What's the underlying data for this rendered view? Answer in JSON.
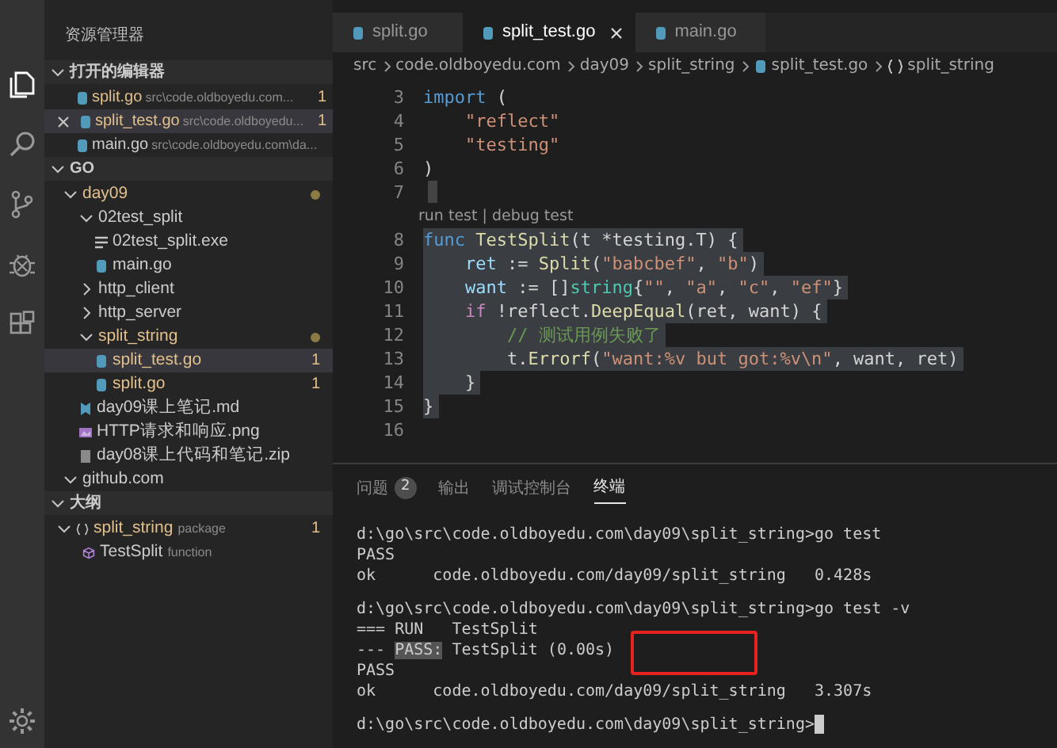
{
  "explorer": {
    "title": "资源管理器",
    "open_editors": {
      "title": "打开的编辑器",
      "expanded": true,
      "items": [
        {
          "name": "split.go",
          "path": "src\\code.oldboyedu.com...",
          "badge": "1",
          "modified": true,
          "selected": false
        },
        {
          "name": "split_test.go",
          "path": "src\\code.oldboyedu...",
          "badge": "1",
          "modified": true,
          "selected": true
        },
        {
          "name": "main.go",
          "path": "src\\code.oldboyedu.com\\da...",
          "modified": false,
          "selected": false
        }
      ]
    },
    "workspace": {
      "title": "GO",
      "expanded": true,
      "tree": [
        {
          "name": "day09",
          "kind": "folder",
          "expanded": true,
          "modified": true,
          "children": [
            {
              "name": "02test_split",
              "kind": "folder",
              "expanded": true,
              "modified": false,
              "children": [
                {
                  "name": "02test_split.exe",
                  "kind": "exe",
                  "modified": false,
                  "selected": false
                },
                {
                  "name": "main.go",
                  "kind": "go",
                  "modified": false,
                  "selected": false
                }
              ]
            },
            {
              "name": "http_client",
              "kind": "folder",
              "expanded": false,
              "modified": false
            },
            {
              "name": "http_server",
              "kind": "folder",
              "expanded": false,
              "modified": false
            },
            {
              "name": "split_string",
              "kind": "folder",
              "expanded": true,
              "modified": true,
              "children": [
                {
                  "name": "split_test.go",
                  "kind": "go",
                  "modified": true,
                  "badge": "1",
                  "selected": true
                },
                {
                  "name": "split.go",
                  "kind": "go",
                  "modified": true,
                  "badge": "1",
                  "selected": false
                }
              ]
            },
            {
              "name": "day09课上笔记.md",
              "kind": "md",
              "modified": false,
              "selected": false
            },
            {
              "name": "HTTP请求和响应.png",
              "kind": "png",
              "modified": false,
              "selected": false
            },
            {
              "name": "day08课上代码和笔记.zip",
              "kind": "zip",
              "modified": false,
              "selected": false
            }
          ]
        },
        {
          "name": "github.com",
          "kind": "folder",
          "expanded": true,
          "modified": false
        }
      ]
    },
    "outline": {
      "title": "大纲",
      "expanded": true,
      "items": [
        {
          "name": "split_string",
          "detail": "package",
          "kind": "package",
          "badge": "1",
          "modified": true,
          "expanded": true,
          "children": [
            {
              "name": "TestSplit",
              "detail": "function",
              "kind": "function",
              "modified": false
            }
          ]
        }
      ]
    }
  },
  "tabs": [
    {
      "label": "split.go",
      "selected": false
    },
    {
      "label": "split_test.go",
      "selected": true
    },
    {
      "label": "main.go",
      "selected": false
    }
  ],
  "breadcrumb": [
    {
      "text": "src",
      "kind": "folder"
    },
    {
      "text": "code.oldboyedu.com",
      "kind": "folder"
    },
    {
      "text": "day09",
      "kind": "folder"
    },
    {
      "text": "split_string",
      "kind": "folder"
    },
    {
      "text": "split_test.go",
      "kind": "file"
    },
    {
      "text": "split_string",
      "kind": "package"
    }
  ],
  "code": [
    {
      "number": "3",
      "selected": false,
      "tokens": [
        {
          "kind": "keyword",
          "text": "import"
        },
        {
          "kind": "plain",
          "text": " ("
        }
      ]
    },
    {
      "number": "4",
      "selected": false,
      "tokens": [
        {
          "kind": "string",
          "text": "    \"reflect\""
        }
      ]
    },
    {
      "number": "5",
      "selected": false,
      "tokens": [
        {
          "kind": "string",
          "text": "    \"testing\""
        }
      ]
    },
    {
      "number": "6",
      "selected": false,
      "tokens": [
        {
          "kind": "plain",
          "text": ")"
        }
      ]
    },
    {
      "number": "7",
      "selected": false,
      "cursor": true
    },
    {
      "kind": "codelens",
      "text": "run test | debug test"
    },
    {
      "number": "8",
      "selected": true,
      "tokens": [
        {
          "kind": "keyword",
          "text": "func"
        },
        {
          "kind": "function",
          "text": " TestSplit"
        },
        {
          "kind": "plain",
          "text": "(t *testing.T) {"
        }
      ]
    },
    {
      "number": "9",
      "selected": true,
      "tokens": [
        {
          "kind": "variable",
          "text": "    ret"
        },
        {
          "kind": "plain",
          "text": " := "
        },
        {
          "kind": "function",
          "text": "Split"
        },
        {
          "kind": "plain",
          "text": "("
        },
        {
          "kind": "string",
          "text": "\"babcbef\""
        },
        {
          "kind": "plain",
          "text": ", "
        },
        {
          "kind": "string",
          "text": "\"b\""
        },
        {
          "kind": "plain",
          "text": ")"
        }
      ]
    },
    {
      "number": "10",
      "selected": true,
      "tokens": [
        {
          "kind": "variable",
          "text": "    want"
        },
        {
          "kind": "plain",
          "text": " := []"
        },
        {
          "kind": "type",
          "text": "string"
        },
        {
          "kind": "plain",
          "text": "{"
        },
        {
          "kind": "string",
          "text": "\"\""
        },
        {
          "kind": "plain",
          "text": ", "
        },
        {
          "kind": "string",
          "text": "\"a\""
        },
        {
          "kind": "plain",
          "text": ", "
        },
        {
          "kind": "string",
          "text": "\"c\""
        },
        {
          "kind": "plain",
          "text": ", "
        },
        {
          "kind": "string",
          "text": "\"ef\""
        },
        {
          "kind": "plain",
          "text": "}"
        }
      ]
    },
    {
      "number": "11",
      "selected": true,
      "tokens": [
        {
          "kind": "control",
          "text": "    if"
        },
        {
          "kind": "plain",
          "text": " !reflect."
        },
        {
          "kind": "function",
          "text": "DeepEqual"
        },
        {
          "kind": "plain",
          "text": "(ret, want) {"
        }
      ]
    },
    {
      "number": "12",
      "selected": true,
      "tokens": [
        {
          "kind": "comment",
          "text": "        // 测试用例失败了"
        }
      ]
    },
    {
      "number": "13",
      "selected": true,
      "tokens": [
        {
          "kind": "plain",
          "text": "        t."
        },
        {
          "kind": "function",
          "text": "Errorf"
        },
        {
          "kind": "plain",
          "text": "("
        },
        {
          "kind": "string",
          "text": "\"want:%v but got:%v\\n\""
        },
        {
          "kind": "plain",
          "text": ", want, ret)"
        }
      ]
    },
    {
      "number": "14",
      "selected": true,
      "tokens": [
        {
          "kind": "plain",
          "text": "    }"
        }
      ]
    },
    {
      "number": "15",
      "selected": true,
      "tokens": [
        {
          "kind": "plain",
          "text": "}"
        }
      ]
    },
    {
      "number": "16",
      "selected": false
    }
  ],
  "panel_tabs": [
    {
      "label": "问题",
      "count": "2",
      "selected": false
    },
    {
      "label": "输出",
      "selected": false
    },
    {
      "label": "调试控制台",
      "selected": false
    },
    {
      "label": "终端",
      "selected": true
    }
  ],
  "terminal": [
    {
      "lines": [
        [
          {
            "text": "d:\\go\\src\\code.oldboyedu.com\\day09\\split_string>go test"
          }
        ],
        [
          {
            "text": "PASS"
          }
        ],
        [
          {
            "text": "ok      code.oldboyedu.com/day09/split_string   0.428s"
          }
        ]
      ]
    },
    {
      "lines": [
        [
          {
            "text": "d:\\go\\src\\code.oldboyedu.com\\day09\\split_string>go test -v"
          }
        ],
        [
          {
            "text": "=== RUN   TestSplit"
          }
        ],
        [
          {
            "text": "--- "
          },
          {
            "text": "PASS:",
            "highlighted": true
          },
          {
            "text": " TestSplit (0.00s)"
          }
        ],
        [
          {
            "text": "PASS"
          }
        ],
        [
          {
            "text": "ok      code.oldboyedu.com/day09/split_string   3.307s"
          }
        ]
      ]
    },
    {
      "lines": [
        [
          {
            "text": "d:\\go\\src\\code.oldboyedu.com\\day09\\split_string>"
          }
        ]
      ]
    }
  ],
  "terminal_cursor": true,
  "annotations": [
    {
      "kind": "rectangle",
      "color": "#e8231f"
    }
  ]
}
